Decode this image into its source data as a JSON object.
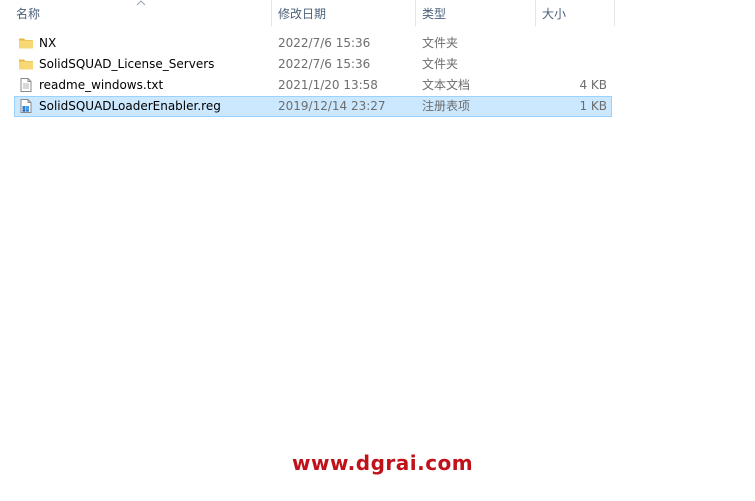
{
  "columns": {
    "name": "名称",
    "date": "修改日期",
    "type": "类型",
    "size": "大小"
  },
  "files": [
    {
      "name": "NX",
      "date": "2022/7/6 15:36",
      "type": "文件夹",
      "size": "",
      "icon": "folder-icon"
    },
    {
      "name": "SolidSQUAD_License_Servers",
      "date": "2022/7/6 15:36",
      "type": "文件夹",
      "size": "",
      "icon": "folder-icon"
    },
    {
      "name": "readme_windows.txt",
      "date": "2021/1/20 13:58",
      "type": "文本文档",
      "size": "4 KB",
      "icon": "text-file-icon"
    },
    {
      "name": "SolidSQUADLoaderEnabler.reg",
      "date": "2019/12/14 23:27",
      "type": "注册表项",
      "size": "1 KB",
      "icon": "registry-file-icon",
      "selected": true
    }
  ],
  "watermark": "www.dgrai.com",
  "colors": {
    "selection_bg": "#cce8ff",
    "selection_border": "#99d1ff",
    "header_text": "#4c607a",
    "folder": "#f8d775",
    "watermark": "#c0121a"
  }
}
